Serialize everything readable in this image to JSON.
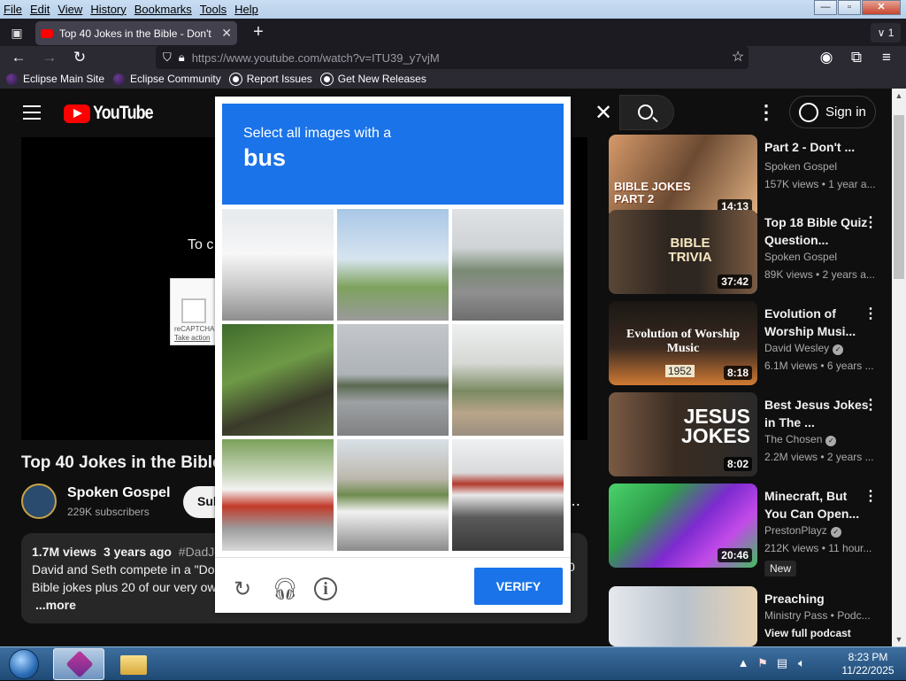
{
  "menu": [
    "File",
    "Edit",
    "View",
    "History",
    "Bookmarks",
    "Tools",
    "Help"
  ],
  "window_controls": {
    "minimize": "—",
    "restore": "▫",
    "close": "✕"
  },
  "tab": {
    "title": "Top 40 Jokes in the Bible - Don't",
    "close": "✕"
  },
  "tab_count": "∨ 1",
  "nav": {
    "url": "https://www.youtube.com/watch?v=ITU39_y7vjM"
  },
  "bookmarks": [
    "Eclipse Main Site",
    "Eclipse Community",
    "Report Issues",
    "Get New Releases"
  ],
  "youtube": {
    "logo": "YouTube",
    "sign_in": "Sign in"
  },
  "player": {
    "message": "To c",
    "recaptcha_label": "reCAPTCHA",
    "recaptcha_link": "Take action"
  },
  "video": {
    "title": "Top 40 Jokes in the Bible",
    "channel": "Spoken Gospel",
    "subscribers": "229K subscribers",
    "subscribe": "Sub",
    "views": "1.7M views",
    "age": "3 years ago",
    "hashtag": "#DadJo",
    "desc_line1": "David and Seth compete in a \"Dor",
    "desc_line2": "Bible jokes plus 20 of our very ow",
    "more": "...more",
    "stray_digit": "0"
  },
  "captcha": {
    "prompt": "Select all images with a",
    "target": "bus",
    "verify": "VERIFY",
    "icons": [
      "reload-icon",
      "headphones-icon",
      "info-icon"
    ]
  },
  "related": [
    {
      "title": "Part 2 - Don't ...",
      "channel": "Spoken Gospel",
      "views": "157K views • 1 year a...",
      "duration": "14:13",
      "thumb_text": "BIBLE JOKES PART 2",
      "colors": [
        "#b97a4a",
        "#e7b48c"
      ]
    },
    {
      "title": "Top 18 Bible Quiz Question...",
      "channel": "Spoken Gospel",
      "views": "89K views • 2 years a...",
      "duration": "37:42",
      "thumb_text": "BIBLE TRIVIA",
      "colors": [
        "#3a3028",
        "#c69a6a"
      ]
    },
    {
      "title": "Evolution of Worship Musi...",
      "channel": "David Wesley",
      "views": "6.1M views • 6 years ...",
      "duration": "8:18",
      "thumb_text": "Evolution of Worship Music",
      "thumb_year": "1952",
      "colors": [
        "#1d1a17",
        "#c76b2e"
      ]
    },
    {
      "title": "Best Jesus Jokes in The ...",
      "channel": "The Chosen",
      "views": "2.2M views • 2 years ...",
      "duration": "8:02",
      "thumb_text": "JESUS JOKES",
      "colors": [
        "#5a4030",
        "#2b2b2b"
      ]
    },
    {
      "title": "Minecraft, But You Can Open...",
      "channel": "PrestonPlayz",
      "views": "212K views • 11 hour...",
      "duration": "20:46",
      "badge": "New",
      "colors": [
        "#4bd36a",
        "#8a2be2"
      ]
    },
    {
      "title": "Preaching",
      "channel": "Ministry Pass • Podc...",
      "views": "View full podcast",
      "colors": [
        "#cfd6de",
        "#e7c39a"
      ]
    }
  ],
  "taskbar": {
    "time": "8:23 PM",
    "date": "11/22/2025"
  }
}
